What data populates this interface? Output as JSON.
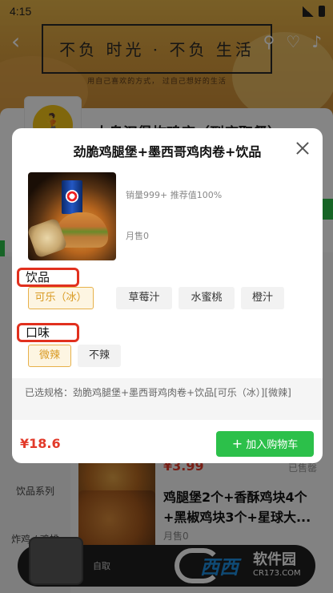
{
  "status_bar": {
    "time": "4:15"
  },
  "header": {
    "banner_title": "不负 时光 · 不负 生活",
    "banner_subtitle": "用自己喜欢的方式，   过自己想好的生活"
  },
  "shop": {
    "name": "大鸟汉堡炸鸡店（到店取餐）"
  },
  "sidebar": {
    "items": [
      "饮品系列",
      "炸鸡 / 鸡排"
    ]
  },
  "background_products": [
    {
      "price": "¥3.99",
      "sold_label": "已售罄"
    },
    {
      "title": "鸡腿堡2个+香酥鸡块4个+黑椒鸡块3个+星球大...",
      "sold": "月售0"
    }
  ],
  "cart": {
    "text": "自取"
  },
  "watermark": {
    "brand": "西西",
    "name": "软件园",
    "url": "CR173.COM"
  },
  "modal": {
    "title": "劲脆鸡腿堡+墨西哥鸡肉卷+饮品",
    "sales_info": "销量999+ 推荐值100%",
    "monthly_sales": "月售0",
    "groups": [
      {
        "label": "饮品",
        "options": [
          "可乐（冰）",
          "草莓汁",
          "水蜜桃",
          "橙汁"
        ],
        "selected": 0
      },
      {
        "label": "口味",
        "options": [
          "微辣",
          "不辣"
        ],
        "selected": 0
      }
    ],
    "summary": "已选规格：劲脆鸡腿堡+墨西哥鸡肉卷+饮品[可乐（冰）][微辣]",
    "price": "¥18.6",
    "add_button": "加入购物车"
  },
  "colors": {
    "accent_green": "#2cc04a",
    "price_red": "#e23a2a",
    "selected_gold": "#d99a22",
    "highlight_red": "#e1301e"
  }
}
